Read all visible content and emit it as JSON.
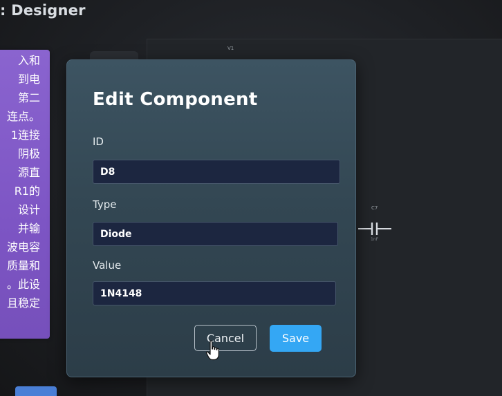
{
  "app": {
    "title": ": Designer"
  },
  "side_panel": {
    "lines": [
      "入和",
      "到电",
      "第二",
      "连点。",
      "1连接",
      "阴极",
      "源直",
      "R1的",
      "设计",
      "并输",
      "波电容",
      "质量和",
      "。此设",
      "且稳定"
    ]
  },
  "schematic": {
    "v1_label": "V1",
    "c7_label": "C7",
    "c7_value": "1nF"
  },
  "dialog": {
    "title": "Edit Component",
    "fields": {
      "id": {
        "label": "ID",
        "value": "D8"
      },
      "type": {
        "label": "Type",
        "value": "Diode"
      },
      "value": {
        "label": "Value",
        "value": "1N4148"
      }
    },
    "cancel_label": "Cancel",
    "save_label": "Save"
  },
  "colors": {
    "accent": "#34a7f4",
    "side_panel": "#7d55c4",
    "dialog_bg": "#334753",
    "input_bg": "#1c2640"
  },
  "icons": {
    "cursor": "hand-pointer-icon",
    "capacitor": "capacitor-symbol-icon"
  }
}
